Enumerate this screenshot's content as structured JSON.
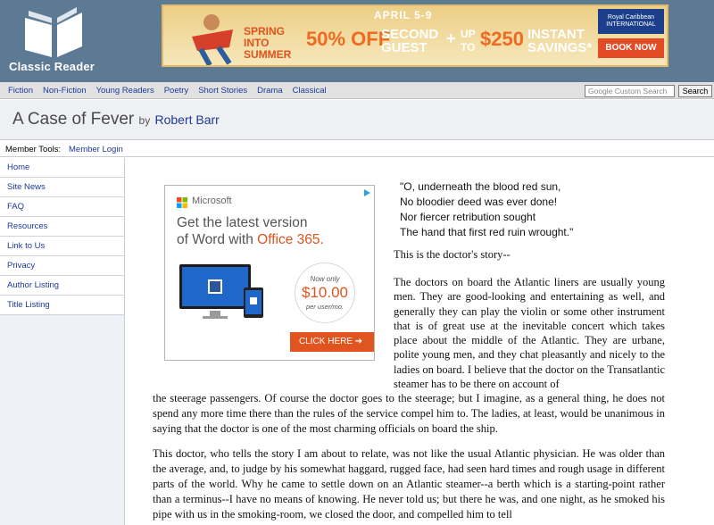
{
  "site": {
    "name": "Classic Reader"
  },
  "banner": {
    "date": "APRIL 5-9",
    "spring": "SPRING INTO SUMMER",
    "off": "50% OFF",
    "second": "SECOND GUEST",
    "plus": "+",
    "upto": "UP TO",
    "amount": "$250",
    "instant": "INSTANT SAVINGS*",
    "brand": "Royal Caribbean INTERNATIONAL",
    "book": "BOOK NOW"
  },
  "nav": {
    "items": [
      "Fiction",
      "Non-Fiction",
      "Young Readers",
      "Poetry",
      "Short Stories",
      "Drama",
      "Classical"
    ],
    "search_placeholder": "Google Custom Search",
    "search_button": "Search"
  },
  "page": {
    "title": "A Case of Fever",
    "by": "by",
    "author": "Robert Barr"
  },
  "member": {
    "label": "Member Tools:",
    "login": "Member Login"
  },
  "sidebar": {
    "items": [
      "Home",
      "Site News",
      "FAQ",
      "Resources",
      "Link to Us",
      "Privacy",
      "Author Listing",
      "Title Listing"
    ]
  },
  "ad": {
    "brand": "Microsoft",
    "headline_1": "Get the latest version",
    "headline_2": "of Word with ",
    "headline_accent": "Office 365.",
    "price_now": "Now only",
    "price": "$10.00",
    "price_per": "per user/mo.",
    "cta": "CLICK HERE  ➔"
  },
  "story": {
    "poem": [
      "\"O, underneath the blood red sun,",
      "No bloodier deed was ever done!",
      "Nor fiercer retribution sought",
      "The hand that first red ruin wrought.\""
    ],
    "intro": "This is the doctor's story--",
    "para1a": "The doctors on board the Atlantic liners are usually young men. They are good-looking and entertaining as well, and generally they can play the violin or some other instrument that is of great use at the inevitable concert which takes place about the middle of the Atlantic. They are urbane, polite young men, and they chat pleasantly and nicely to the ladies on board. I believe that the doctor on the Transatlantic steamer has to be there on account of",
    "para1b": "the steerage passengers. Of course the doctor goes to the steerage; but I imagine, as a general thing, he does not spend any more time there than the rules of the service compel him to. The ladies, at least, would be unanimous in saying that the doctor is one of the most charming officials on board the ship.",
    "para2": "This doctor, who tells the story I am about to relate, was not like the usual Atlantic physician. He was older than the average, and, to judge by his somewhat haggard, rugged face, had seen hard times and rough usage in different parts of the world. Why he came to settle down on an Atlantic steamer--a berth which is a starting-point rather than a terminus--I have no means of knowing. He never told us; but there he was, and one night, as he smoked his pipe with us in the smoking-room, we closed the door, and compelled him to tell"
  }
}
